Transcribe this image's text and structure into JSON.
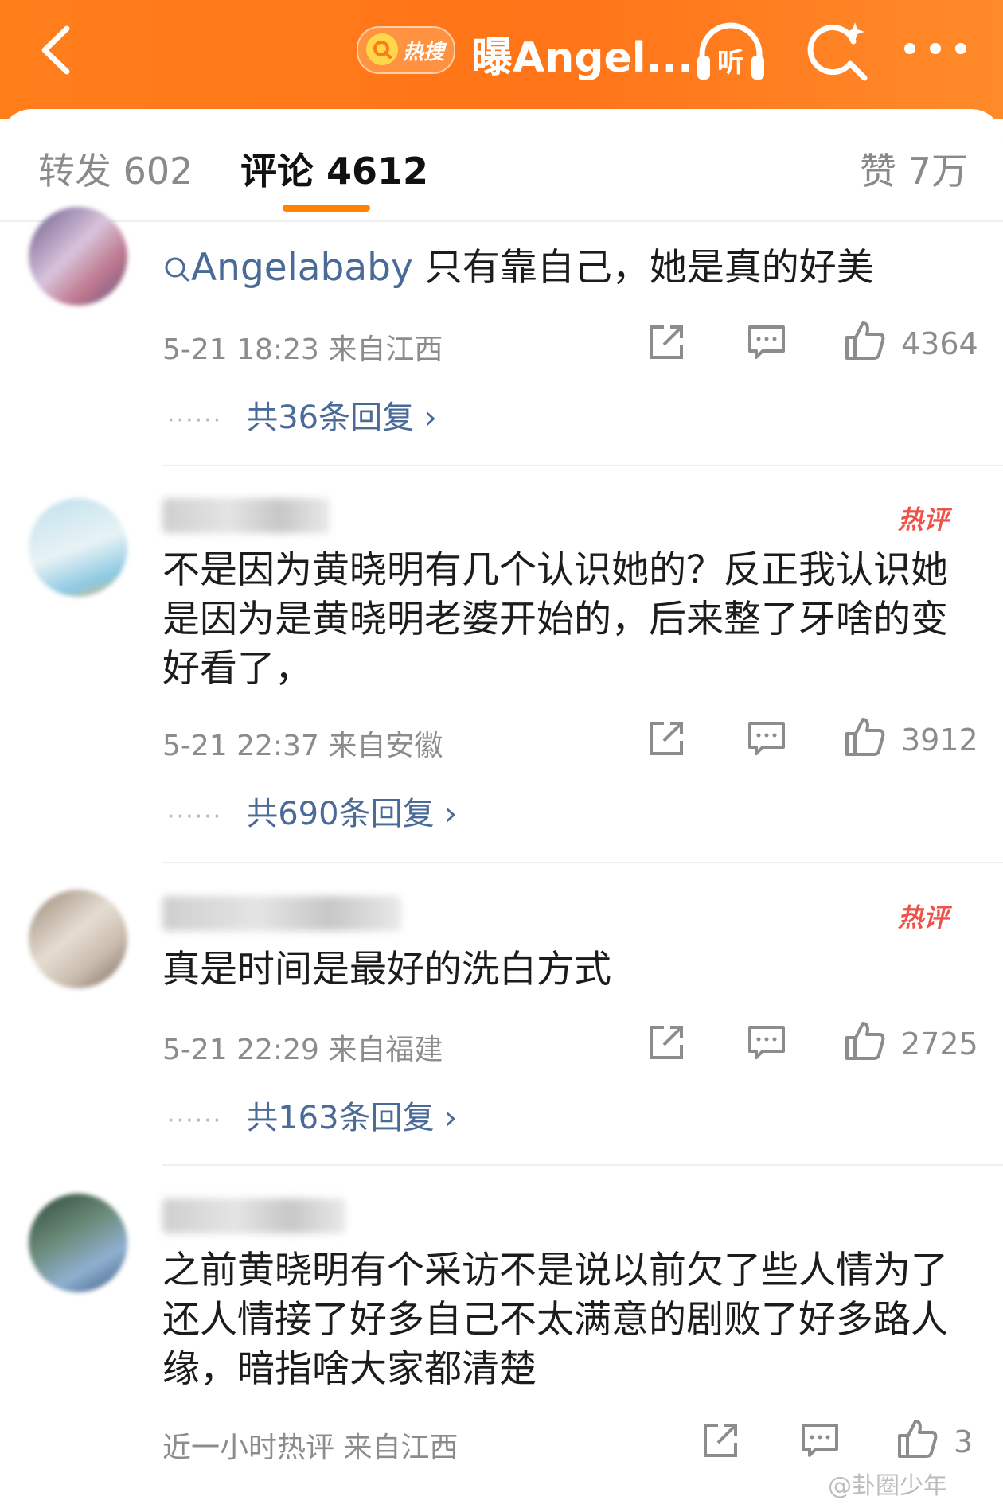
{
  "header": {
    "hot_search_label": "热搜",
    "title": "曝Angel...",
    "listen_label": "听"
  },
  "tabs": {
    "repost": "转发 602",
    "comment": "评论 4612",
    "like": "赞 7万"
  },
  "colors": {
    "accent": "#ff8200",
    "hot_tag": "#f0524a",
    "link": "#4a6a98"
  },
  "comments": [
    {
      "mention": "Angelababy",
      "text": " 只有靠自己，她是真的好美",
      "meta": "5-21 18:23  来自江西",
      "likes": "4364",
      "replies": "共36条回复"
    },
    {
      "hot_tag": "热评",
      "text": "不是因为黄晓明有几个认识她的？反正我认识她是因为是黄晓明老婆开始的，后来整了牙啥的变好看了，",
      "meta": "5-21 22:37  来自安徽",
      "likes": "3912",
      "replies": "共690条回复"
    },
    {
      "hot_tag": "热评",
      "text": "真是时间是最好的洗白方式",
      "meta": "5-21 22:29  来自福建",
      "likes": "2725",
      "replies": "共163条回复"
    },
    {
      "text": "之前黄晓明有个采访不是说以前欠了些人情为了还人情接了好多自己不太满意的剧败了好多路人缘，暗指啥大家都清楚",
      "meta": "近一小时热评  来自江西",
      "likes": "3"
    }
  ],
  "replies_dots": "······",
  "replies_arrow": "›",
  "watermark": "@卦圈少年"
}
